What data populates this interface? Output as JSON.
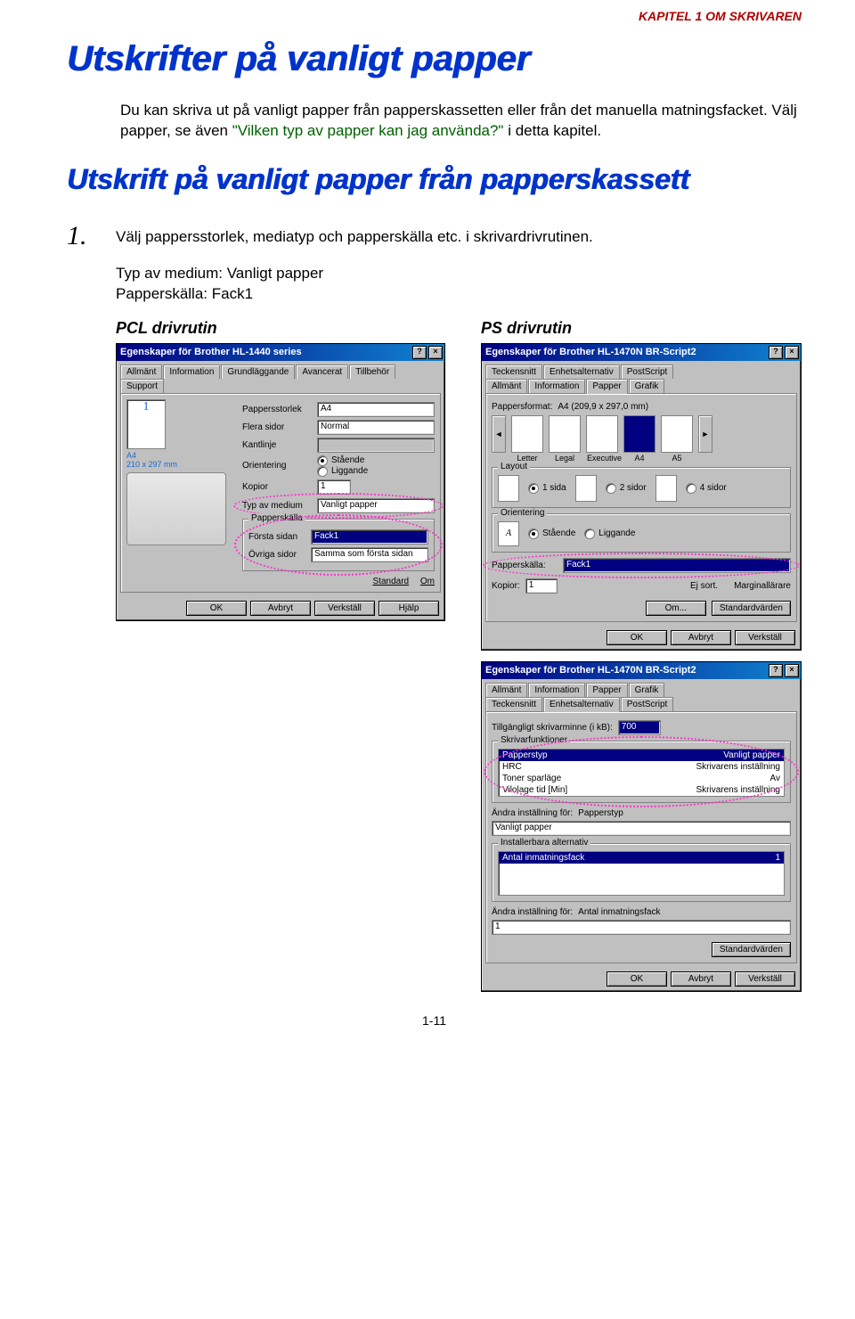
{
  "chapter_header": "KAPITEL 1 OM SKRIVAREN",
  "page_title": "Utskrifter på vanligt papper",
  "intro_parts": {
    "a": "Du kan skriva ut på vanligt papper från papperskassetten eller från det manuella matningsfacket. Välj papper, se även ",
    "link": "\"Vilken typ av papper kan jag använda?\"",
    "b": " i detta kapitel."
  },
  "subtitle": "Utskrift på vanligt papper från papperskassett",
  "step1": {
    "num": "1.",
    "text": "Välj pappersstorlek, mediatyp och papperskälla etc. i skrivardrivrutinen."
  },
  "settings": {
    "l1": "Typ av medium: Vanligt papper",
    "l2": "Papperskälla: Fack1"
  },
  "pcl_heading": "PCL drivrutin",
  "ps_heading": "PS drivrutin",
  "pcl_dialog": {
    "title": "Egenskaper för Brother HL-1440 series",
    "tabs": [
      "Allmänt",
      "Information",
      "Grundläggande",
      "Avancerat",
      "Tillbehör",
      "Support"
    ],
    "active_tab": "Grundläggande",
    "preview_num": "1",
    "preview_caption": "A4\n210 x 297 mm",
    "fields": {
      "pappersstorlek": {
        "label": "Pappersstorlek",
        "value": "A4"
      },
      "flera_sidor": {
        "label": "Flera sidor",
        "value": "Normal"
      },
      "kantlinje": {
        "label": "Kantlinje",
        "value": ""
      },
      "orientering": {
        "label": "Orientering",
        "opt1": "Stående",
        "opt2": "Liggande"
      },
      "kopior": {
        "label": "Kopior",
        "value": "1"
      },
      "typ_av_medium": {
        "label": "Typ av medium",
        "value": "Vanligt papper"
      },
      "papperskalla": {
        "label": "Papperskälla"
      },
      "forsta_sidan": {
        "label": "Första sidan",
        "value": "Fack1"
      },
      "ovriga_sidor": {
        "label": "Övriga sidor",
        "value": "Samma som första sidan"
      }
    },
    "link_buttons": {
      "standard": "Standard",
      "om": "Om"
    },
    "buttons": {
      "ok": "OK",
      "avbryt": "Avbryt",
      "verkstall": "Verkställ",
      "hjalp": "Hjälp"
    }
  },
  "ps1_dialog": {
    "title": "Egenskaper för Brother HL-1470N BR-Script2",
    "tabs_row1": [
      "Teckensnitt",
      "Enhetsalternativ",
      "PostScript"
    ],
    "tabs_row2": [
      "Allmänt",
      "Information",
      "Papper",
      "Grafik"
    ],
    "active_tab": "Papper",
    "pappersformat": {
      "label": "Pappersformat:",
      "value": "A4 (209,9 x 297,0 mm)"
    },
    "formats": [
      "Letter",
      "Legal",
      "Executive",
      "A4",
      "A5"
    ],
    "selected_format_index": 3,
    "layout": {
      "label": "Layout",
      "opts": [
        "1 sida",
        "2 sidor",
        "4 sidor"
      ]
    },
    "orientering": {
      "label": "Orientering",
      "a": "A",
      "opt1": "Stående",
      "opt2": "Liggande"
    },
    "papperskalla": {
      "label": "Papperskälla:",
      "value": "Fack1"
    },
    "kopior": {
      "label": "Kopior:",
      "value": "1"
    },
    "copy_opts": {
      "ej_sort": "Ej sort.",
      "marginallare": "Marginallärare"
    },
    "om_btn": "Om...",
    "standard_btn": "Standardvärden",
    "buttons": {
      "ok": "OK",
      "avbryt": "Avbryt",
      "verkstall": "Verkställ"
    }
  },
  "ps2_dialog": {
    "title": "Egenskaper för Brother HL-1470N BR-Script2",
    "tabs_row1": [
      "Allmänt",
      "Information",
      "Papper",
      "Grafik"
    ],
    "tabs_row2": [
      "Teckensnitt",
      "Enhetsalternativ",
      "PostScript"
    ],
    "active_tab": "Enhetsalternativ",
    "mem": {
      "label": "Tillgängligt skrivarminne (i kB):",
      "value": "700"
    },
    "funktioner": {
      "label": "Skrivarfunktioner",
      "rows": [
        {
          "k": "Papperstyp",
          "v": "Vanligt papper",
          "sel": true
        },
        {
          "k": "HRC",
          "v": "Skrivarens inställning"
        },
        {
          "k": "Toner sparläge",
          "v": "Av"
        },
        {
          "k": "Vilolage tid [Min]",
          "v": "Skrivarens inställning"
        }
      ]
    },
    "andra1": {
      "label": "Ändra inställning för:",
      "target": "Papperstyp",
      "value": "Vanligt papper"
    },
    "installerbara": {
      "label": "Installerbara alternativ",
      "item": "Antal inmatningsfack",
      "val": "1"
    },
    "andra2": {
      "label": "Ändra inställning för:",
      "target": "Antal inmatningsfack",
      "value": "1"
    },
    "standard_btn": "Standardvärden",
    "buttons": {
      "ok": "OK",
      "avbryt": "Avbryt",
      "verkstall": "Verkställ"
    }
  },
  "page_number": "1-11"
}
